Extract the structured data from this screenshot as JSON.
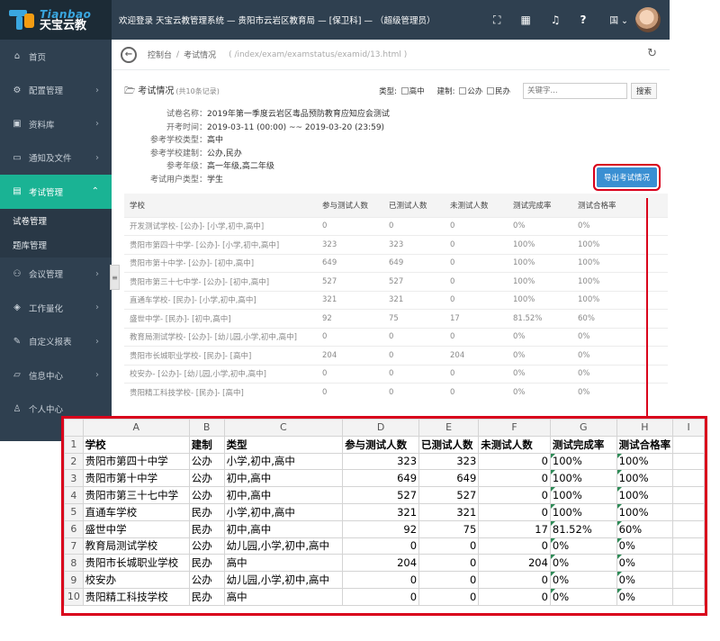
{
  "brand": {
    "latin": "Tianbao",
    "chinese": "天宝云教"
  },
  "topbar": {
    "welcome": "欢迎登录 天宝云教管理系统 — 贵阳市云岩区教育局 — [保卫科] — （超级管理员）",
    "lang": "国 ⌄"
  },
  "sidebar": {
    "items": [
      {
        "label": "首页",
        "icon": "home-icon",
        "glyph": "⌂",
        "chevron": ""
      },
      {
        "label": "配置管理",
        "icon": "gear-icon",
        "glyph": "⚙",
        "chevron": "›"
      },
      {
        "label": "资料库",
        "icon": "database-icon",
        "glyph": "▣",
        "chevron": "›"
      },
      {
        "label": "通知及文件",
        "icon": "message-icon",
        "glyph": "▭",
        "chevron": "›"
      },
      {
        "label": "考试管理",
        "icon": "book-icon",
        "glyph": "▤",
        "chevron": "⌃"
      }
    ],
    "sub_items": [
      "试卷管理",
      "题库管理"
    ],
    "items_after": [
      {
        "label": "会议管理",
        "icon": "group-icon",
        "glyph": "⚇",
        "chevron": "›"
      },
      {
        "label": "工作量化",
        "icon": "cube-icon",
        "glyph": "◈",
        "chevron": "›"
      },
      {
        "label": "自定义报表",
        "icon": "edit-icon",
        "glyph": "✎",
        "chevron": "›"
      },
      {
        "label": "信息中心",
        "icon": "folder-open-icon",
        "glyph": "▱",
        "chevron": "›"
      },
      {
        "label": "个人中心",
        "icon": "user-icon",
        "glyph": "♙",
        "chevron": ""
      }
    ]
  },
  "breadcrumb": {
    "home": "控制台",
    "current": "考试情况",
    "path": "( /index/exam/examstatus/examid/13.html )"
  },
  "panel": {
    "title": "考试情况",
    "count": "(共10条记录)",
    "filter_type_label": "类型:",
    "filter_type_option": "高中",
    "filter_system_label": "建制:",
    "filter_system_options": [
      "公办",
      "民办"
    ],
    "search_placeholder": "关键字...",
    "search_button": "搜索",
    "export_button": "导出考试情况"
  },
  "exam_info": [
    {
      "key": "试卷名称：",
      "value": "2019年第一季度云岩区毒品预防教育应知应会测试"
    },
    {
      "key": "开考时间：",
      "value": "2019-03-11 (00:00) ~~ 2019-03-20 (23:59)"
    },
    {
      "key": "参考学校类型：",
      "value": "高中"
    },
    {
      "key": "参考学校建制：",
      "value": "公办,民办"
    },
    {
      "key": "参考年级：",
      "value": "高一年级,高二年级"
    },
    {
      "key": "考试用户类型：",
      "value": "学生"
    }
  ],
  "school_table": {
    "headers": [
      "学校",
      "参与测试人数",
      "已测试人数",
      "未测试人数",
      "测试完成率",
      "测试合格率"
    ],
    "rows": [
      [
        "开发测试学校- [公办]- [小学,初中,高中]",
        "0",
        "0",
        "0",
        "0%",
        "0%"
      ],
      [
        "贵阳市第四十中学- [公办]- [小学,初中,高中]",
        "323",
        "323",
        "0",
        "100%",
        "100%"
      ],
      [
        "贵阳市第十中学- [公办]- [初中,高中]",
        "649",
        "649",
        "0",
        "100%",
        "100%"
      ],
      [
        "贵阳市第三十七中学- [公办]- [初中,高中]",
        "527",
        "527",
        "0",
        "100%",
        "100%"
      ],
      [
        "直通车学校- [民办]- [小学,初中,高中]",
        "321",
        "321",
        "0",
        "100%",
        "100%"
      ],
      [
        "盛世中学- [民办]- [初中,高中]",
        "92",
        "75",
        "17",
        "81.52%",
        "60%"
      ],
      [
        "教育局测试学校- [公办]- [幼儿园,小学,初中,高中]",
        "0",
        "0",
        "0",
        "0%",
        "0%"
      ],
      [
        "贵阳市长城职业学校- [民办]- [高中]",
        "204",
        "0",
        "204",
        "0%",
        "0%"
      ],
      [
        "校安办- [公办]- [幼儿园,小学,初中,高中]",
        "0",
        "0",
        "0",
        "0%",
        "0%"
      ],
      [
        "贵阳精工科技学校- [民办]- [高中]",
        "0",
        "0",
        "0",
        "0%",
        "0%"
      ]
    ]
  },
  "spreadsheet": {
    "columns": [
      "",
      "A",
      "B",
      "C",
      "D",
      "E",
      "F",
      "G",
      "H",
      "I"
    ],
    "header_row": [
      "学校",
      "建制",
      "类型",
      "参与测试人数",
      "已测试人数",
      "未测试人数",
      "测试完成率",
      "测试合格率"
    ],
    "rows": [
      [
        "贵阳市第四十中学",
        "公办",
        "小学,初中,高中",
        "323",
        "323",
        "0",
        "100%",
        "100%"
      ],
      [
        "贵阳市第十中学",
        "公办",
        "初中,高中",
        "649",
        "649",
        "0",
        "100%",
        "100%"
      ],
      [
        "贵阳市第三十七中学",
        "公办",
        "初中,高中",
        "527",
        "527",
        "0",
        "100%",
        "100%"
      ],
      [
        "直通车学校",
        "民办",
        "小学,初中,高中",
        "321",
        "321",
        "0",
        "100%",
        "100%"
      ],
      [
        "盛世中学",
        "民办",
        "初中,高中",
        "92",
        "75",
        "17",
        "81.52%",
        "60%"
      ],
      [
        "教育局测试学校",
        "公办",
        "幼儿园,小学,初中,高中",
        "0",
        "0",
        "0",
        "0%",
        "0%"
      ],
      [
        "贵阳市长城职业学校",
        "民办",
        "高中",
        "204",
        "0",
        "204",
        "0%",
        "0%"
      ],
      [
        "校安办",
        "公办",
        "幼儿园,小学,初中,高中",
        "0",
        "0",
        "0",
        "0%",
        "0%"
      ],
      [
        "贵阳精工科技学校",
        "民办",
        "高中",
        "0",
        "0",
        "0",
        "0%",
        "0%"
      ]
    ]
  },
  "colors": {
    "sidebar": "#2f4050",
    "active": "#1ab394",
    "export": "#3a8fd2",
    "highlight": "#d9001b"
  }
}
